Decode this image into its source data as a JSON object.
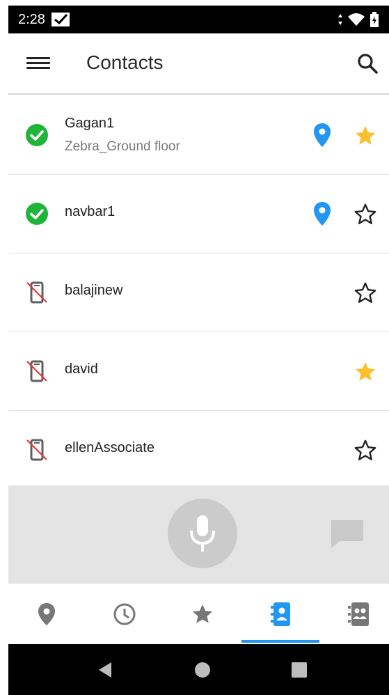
{
  "status_bar": {
    "time": "2:28",
    "icons": [
      "message-check-icon",
      "data-arrows-icon",
      "wifi-icon",
      "battery-charging-icon"
    ]
  },
  "app_bar": {
    "title": "Contacts",
    "menu_icon": "hamburger-menu-icon",
    "search_icon": "search-icon"
  },
  "contacts": [
    {
      "name": "Gagan1",
      "subtitle": "Zebra_Ground floor",
      "status": "available",
      "has_location": true,
      "favorite": true
    },
    {
      "name": "navbar1",
      "subtitle": "",
      "status": "available",
      "has_location": true,
      "favorite": false
    },
    {
      "name": "balajinew",
      "subtitle": "",
      "status": "offline",
      "has_location": false,
      "favorite": false
    },
    {
      "name": "david",
      "subtitle": "",
      "status": "offline",
      "has_location": false,
      "favorite": true
    },
    {
      "name": "ellenAssociate",
      "subtitle": "",
      "status": "offline",
      "has_location": false,
      "favorite": false
    }
  ],
  "voice_panel": {
    "mic_icon": "microphone-icon",
    "chat_icon": "chat-bubble-icon"
  },
  "bottom_nav": {
    "tabs": [
      "location-icon",
      "history-clock-icon",
      "favorites-star-icon",
      "contacts-icon",
      "groups-icon"
    ],
    "selected_index": 3
  },
  "system_nav": [
    "back-icon",
    "home-icon",
    "recents-icon"
  ],
  "colors": {
    "accent_blue": "#2196f3",
    "available_green": "#1eb53a",
    "favorite_gold": "#fbc02d",
    "offline_red": "#e53935"
  }
}
